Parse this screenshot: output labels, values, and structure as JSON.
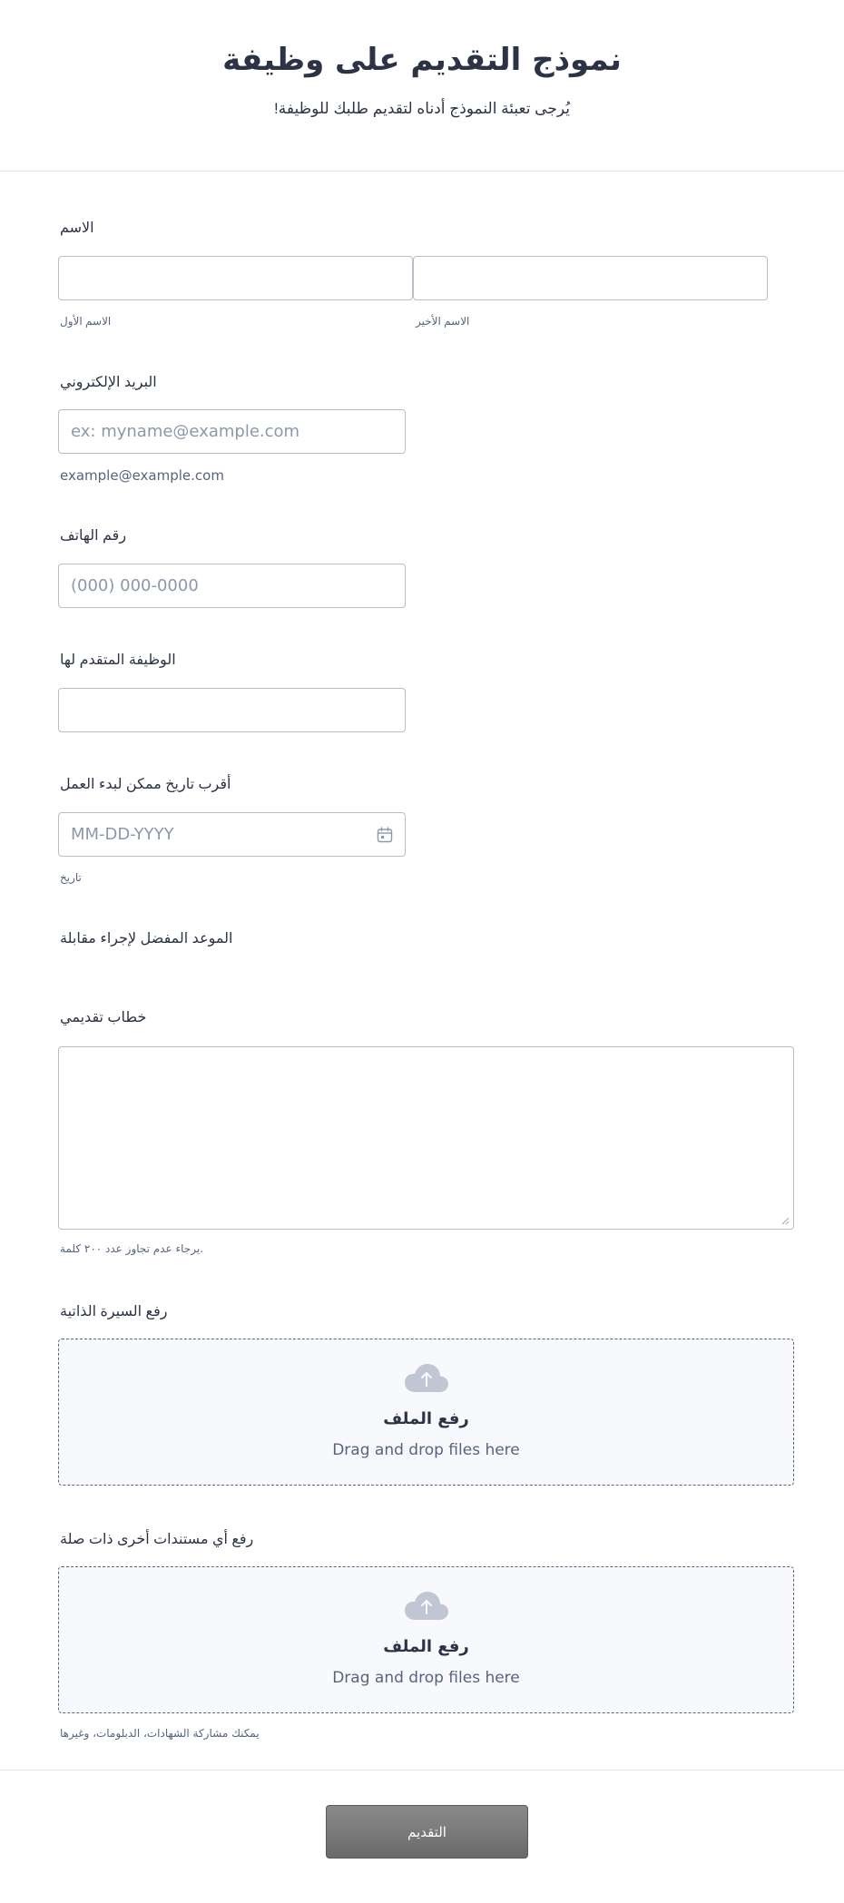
{
  "header": {
    "title": "نموذج التقديم على وظيفة",
    "subtitle": "!يُرجى تعبئة النموذج أدناه لتقديم طلبك للوظيفة"
  },
  "name_field": {
    "label": "الاسم",
    "first_sublabel": "الاسم الأول",
    "last_sublabel": "الاسم الأخير",
    "first_value": "",
    "last_value": ""
  },
  "email_field": {
    "label": "البريد الإلكتروني",
    "placeholder": "ex: myname@example.com",
    "hint": "example@example.com",
    "value": ""
  },
  "phone_field": {
    "label": "رقم الهاتف",
    "placeholder": "(000) 000-0000",
    "value": ""
  },
  "position_field": {
    "label": "الوظيفة المتقدم لها",
    "value": ""
  },
  "start_date_field": {
    "label": "أقرب تاريخ ممكن لبدء العمل",
    "placeholder": "MM-DD-YYYY",
    "sublabel": "تاريخ",
    "icon": "calendar-icon"
  },
  "interview_field": {
    "label": "الموعد المفضل لإجراء مقابلة"
  },
  "cover_letter_field": {
    "label": "خطاب تقديمي",
    "hint": "يرجاء عدم تجاوز عدد ٢٠٠ كلمة."
  },
  "cv_upload": {
    "label": "رفع السيرة الذاتية",
    "title": "رفع الملف",
    "subtitle": "Drag and drop files here",
    "icon": "cloud-upload-icon"
  },
  "docs_upload": {
    "label": "رفع أي مستندات أخرى ذات صلة",
    "title": "رفع الملف",
    "subtitle": "Drag and drop files here",
    "hint": "يمكنك مشاركة الشهادات، الدبلومات، وغيرها",
    "icon": "cloud-upload-icon"
  },
  "submit": {
    "label": "التقديم"
  },
  "colors": {
    "text": "#2c3345",
    "muted": "#57647e",
    "border": "#b8bdc9",
    "upload_bg": "#f8f9fc",
    "button": "#6f6f6f"
  }
}
